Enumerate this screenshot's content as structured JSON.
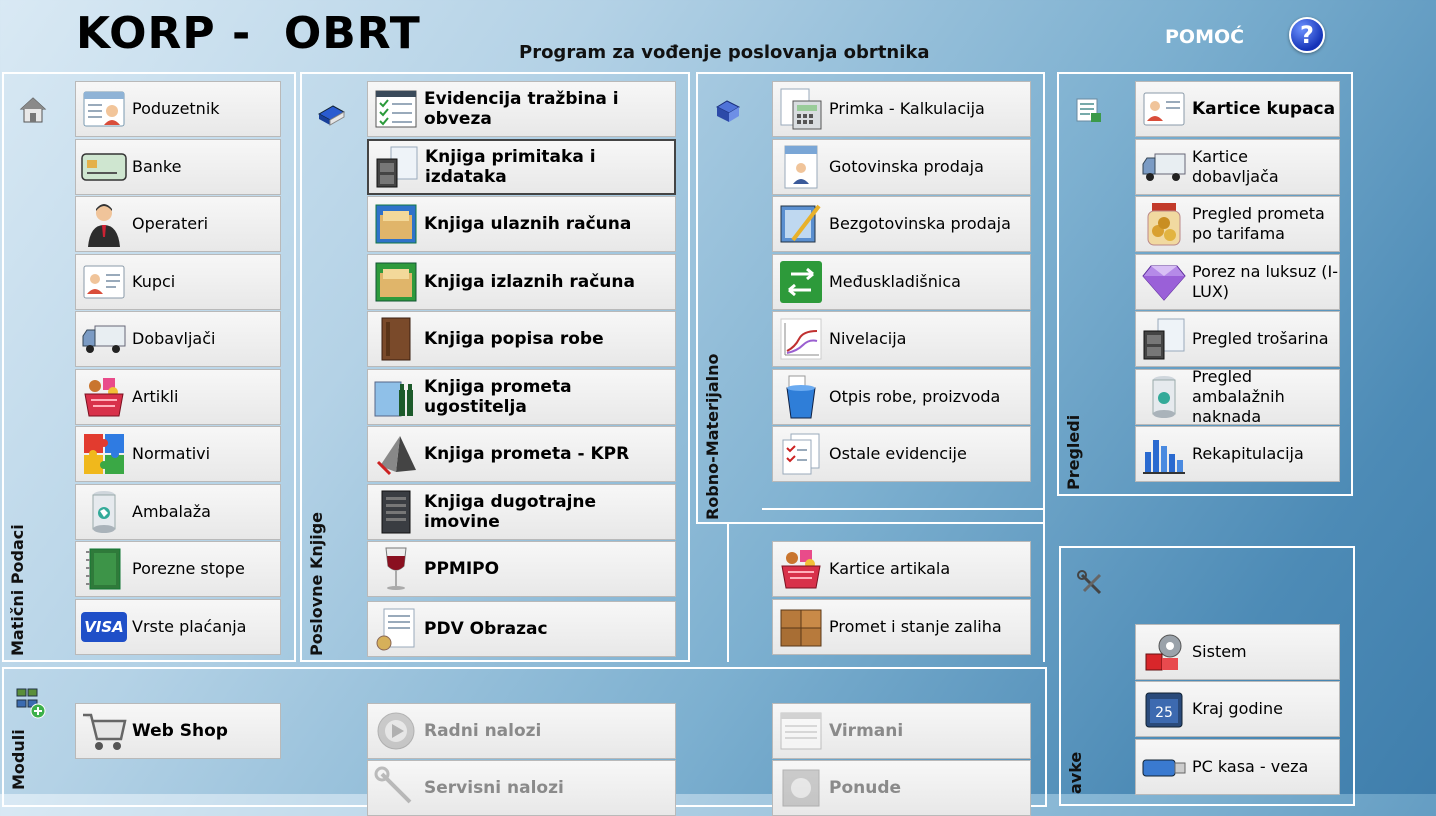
{
  "header": {
    "title": "KORP -  OBRT",
    "subtitle": "Program za vođenje poslovanja obrtnika",
    "help_label": "POMOĆ",
    "help_icon": "?"
  },
  "sections": {
    "maticni": "Matični Podaci",
    "poslovne": "Poslovne Knjige",
    "robno": "Robno-Materijalno",
    "pregledi": "Pregledi",
    "moduli": "Moduli",
    "postavke": "avke"
  },
  "maticni_items": [
    "Poduzetnik",
    "Banke",
    "Operateri",
    "Kupci",
    "Dobavljači",
    "Artikli",
    "Normativi",
    "Ambalaža",
    "Porezne stope",
    "Vrste plaćanja"
  ],
  "poslovne_items": [
    "Evidencija tražbina i obveza",
    "Knjiga primitaka i izdataka",
    "Knjiga ulaznih računa",
    "Knjiga izlaznih računa",
    "Knjiga popisa robe",
    "Knjiga prometa ugostitelja",
    "Knjiga prometa - KPR",
    "Knjiga dugotrajne imovine",
    "PPMIPO",
    "PDV Obrazac"
  ],
  "robno_items": [
    "Primka - Kalkulacija",
    "Gotovinska prodaja",
    "Bezgotovinska prodaja",
    "Međuskladišnica",
    "Nivelacija",
    "Otpis robe, proizvoda",
    "Ostale evidencije"
  ],
  "robno_lower_items": [
    "Kartice artikala",
    "Promet i stanje zaliha"
  ],
  "pregledi_items": [
    "Kartice kupaca",
    "Kartice dobavljača",
    "Pregled prometa po tarifama",
    "Porez na luksuz (I-LUX)",
    "Pregled trošarina",
    "Pregled ambalažnih naknada",
    "Rekapitulacija"
  ],
  "moduli_items": [
    "Web Shop",
    "Radni nalozi",
    "Servisni nalozi",
    "Virmani",
    "Ponude"
  ],
  "postavke_items": [
    "Sistem",
    "Kraj godine",
    "PC kasa - veza"
  ],
  "visa_text": "VISA",
  "colors": {
    "accent_help": "#1533b8",
    "button_bg": "#f0f0f0",
    "disabled_text": "#8a8a8a"
  }
}
